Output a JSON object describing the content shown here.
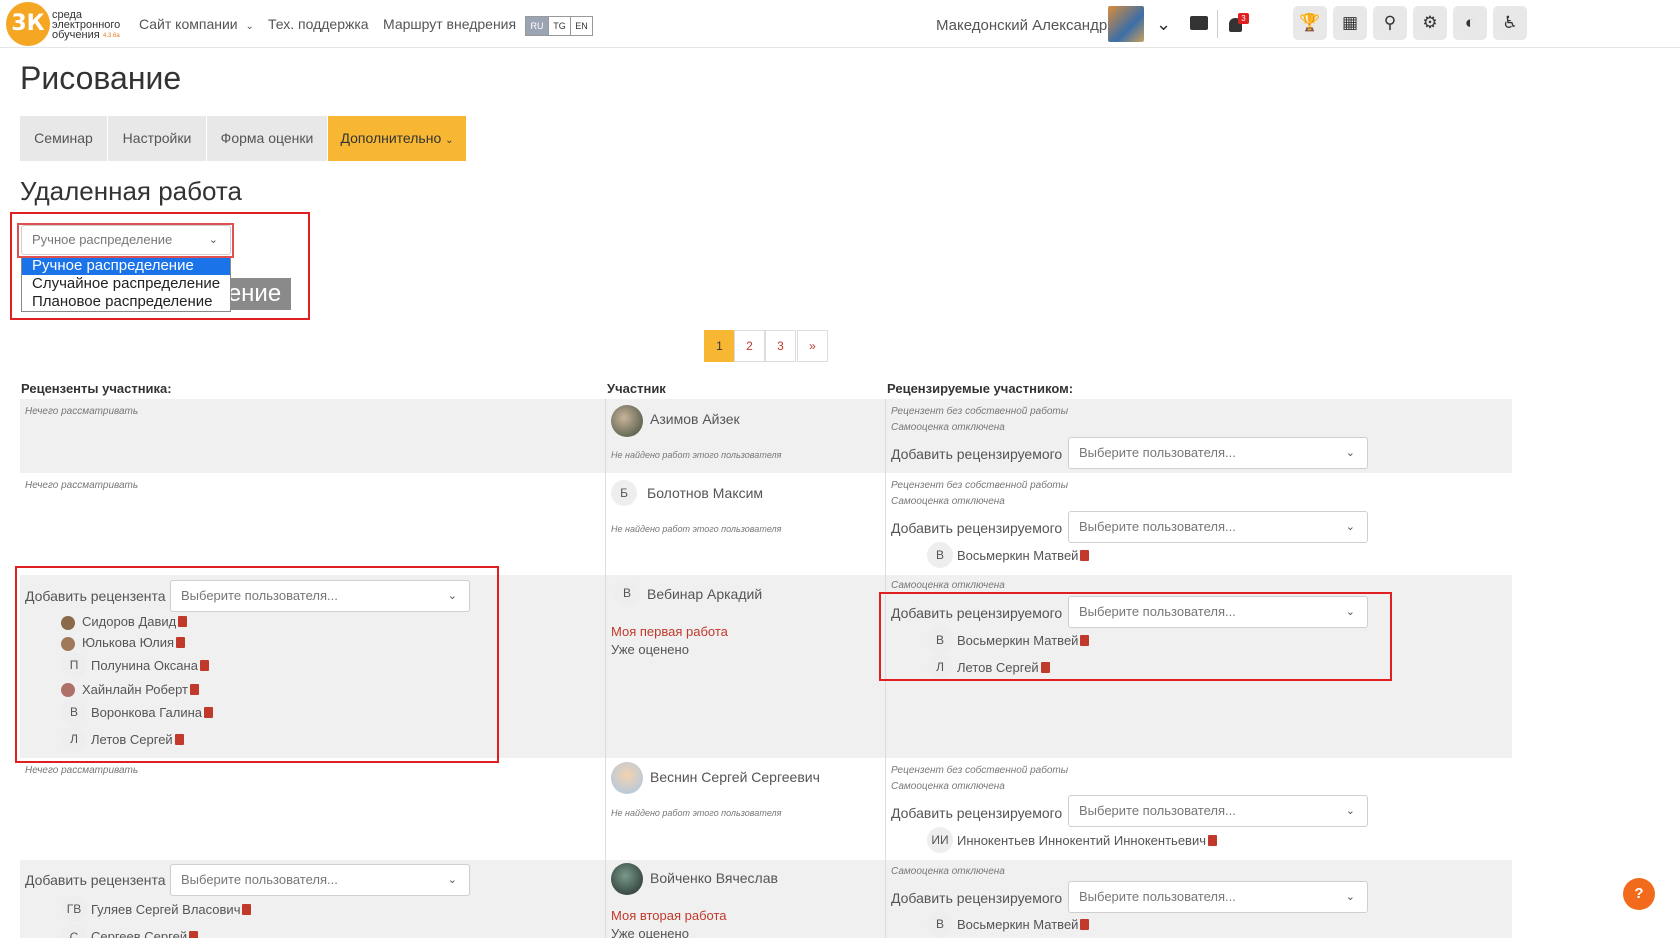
{
  "header": {
    "logo_text": "3К",
    "logo_lines": [
      "среда",
      "электронного",
      "обучения"
    ],
    "logo_version": "4.3.6a",
    "nav": [
      "Сайт компании",
      "Тех. поддержка",
      "Маршрут внедрения"
    ],
    "langs": [
      "RU",
      "TG",
      "EN"
    ],
    "user_name": "Македонский Александр",
    "notif_count": "3"
  },
  "page": {
    "title": "Рисование",
    "tabs": [
      "Семинар",
      "Настройки",
      "Форма оценки",
      "Дополнительно"
    ],
    "section_title": "Удаленная работа",
    "strategy_selected": "Ручное распределение",
    "strategy_options": [
      "Ручное распределение",
      "Случайное распределение",
      "Плановое распределение"
    ],
    "hidden_button_fragment": "ение"
  },
  "pagination": [
    "1",
    "2",
    "3",
    "»"
  ],
  "columns": {
    "reviewers": "Рецензенты участника:",
    "participant": "Участник",
    "reviewees": "Рецензируемые участником:"
  },
  "common": {
    "nothing": "Нечего рассматривать",
    "no_work": "Не найдено работ этого пользователя",
    "own_missing": "Рецензент без собственной работы",
    "self_off": "Самооценка отключена",
    "add_reviewee": "Добавить рецензируемого",
    "add_reviewer": "Добавить рецензента",
    "choose_user": "Выберите пользователя...",
    "graded": "Уже оценено"
  },
  "rows": [
    {
      "participant": "Азимов Айзек"
    },
    {
      "participant": "Болотнов Максим",
      "initial": "Б",
      "reviewees": [
        {
          "i": "В",
          "name": "Восьмеркин Матвей"
        }
      ]
    },
    {
      "participant": "Вебинар Аркадий",
      "initial": "В",
      "work": "Моя первая работа",
      "reviewers": [
        {
          "i": "",
          "name": "Сидоров Давид"
        },
        {
          "i": "",
          "name": "Юлькова Юлия"
        },
        {
          "i": "П",
          "name": "Полунина Оксана"
        },
        {
          "i": "",
          "name": "Хайнлайн Роберт"
        },
        {
          "i": "В",
          "name": "Воронкова Галина"
        },
        {
          "i": "Л",
          "name": "Летов Сергей"
        }
      ],
      "reviewees": [
        {
          "i": "В",
          "name": "Восьмеркин Матвей"
        },
        {
          "i": "Л",
          "name": "Летов Сергей"
        }
      ]
    },
    {
      "participant": "Веснин Сергей Сергеевич",
      "reviewees": [
        {
          "i": "ИИ",
          "name": "Иннокентьев Иннокентий Иннокентьевич"
        }
      ]
    },
    {
      "participant": "Войченко Вячеслав",
      "work": "Моя вторая работа",
      "reviewers": [
        {
          "i": "ГВ",
          "name": "Гуляев Сергей Власович"
        },
        {
          "i": "С",
          "name": "Сергеев Сергей"
        }
      ],
      "reviewees": [
        {
          "i": "В",
          "name": "Восьмеркин Матвей"
        }
      ]
    }
  ],
  "help": "?"
}
